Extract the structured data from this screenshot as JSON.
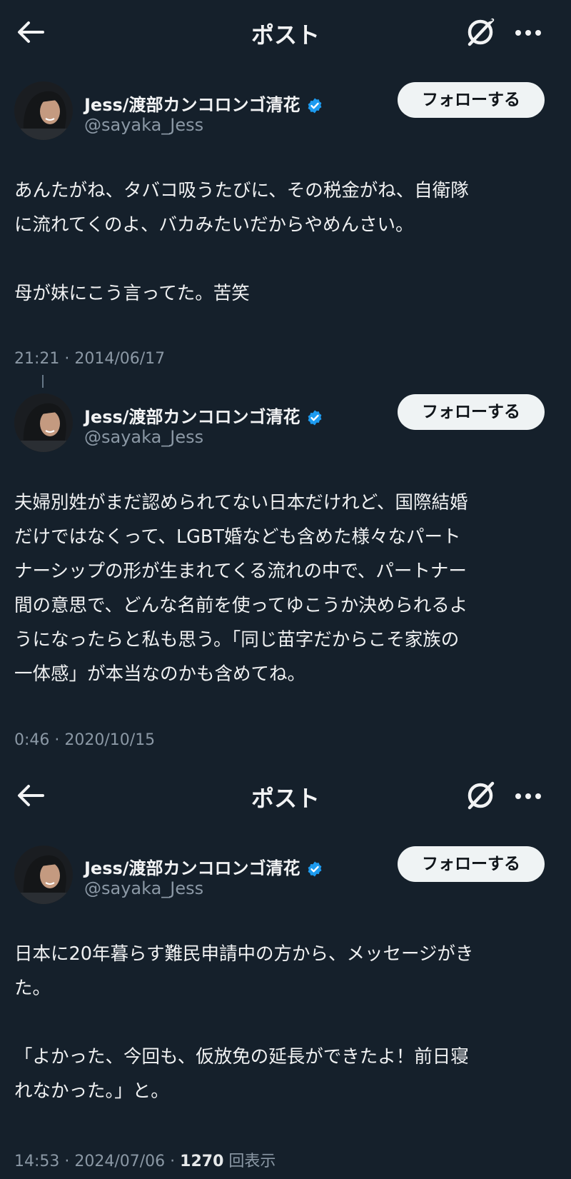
{
  "headers": [
    {
      "title": "ポスト",
      "icons": [
        "back-arrow-icon",
        "grok-icon",
        "more-icon"
      ]
    },
    {
      "title": "ポスト",
      "icons": [
        "back-arrow-icon",
        "grok-icon",
        "more-icon"
      ]
    }
  ],
  "posts": [
    {
      "author": {
        "name": "Jess/渡部カンコロンゴ清花",
        "handle": "@sayaka_Jess",
        "verified": true
      },
      "follow_label": "フォローする",
      "text": "あんたがね、タバコ吸うたびに、その税金がね、自衛隊\nに流れてくのよ、バカみたいだからやめんさい。\n\n母が妹にこう言ってた。苦笑",
      "timestamp": "21:21 · 2014/06/17"
    },
    {
      "author": {
        "name": "Jess/渡部カンコロンゴ清花",
        "handle": "@sayaka_Jess",
        "verified": true
      },
      "follow_label": "フォローする",
      "text": "夫婦別姓がまだ認められてない日本だけれど、国際結婚\nだけではなくって、LGBT婚なども含めた様々なパート\nナーシップの形が生まれてくる流れの中で、パートナー\n間の意思で、どんな名前を使ってゆこうか決められるよ\nうになったらと私も思う。「同じ苗字だからこそ家族の\n一体感」が本当なのかも含めてね。",
      "timestamp": "0:46 · 2020/10/15"
    },
    {
      "author": {
        "name": "Jess/渡部カンコロンゴ清花",
        "handle": "@sayaka_Jess",
        "verified": true
      },
      "follow_label": "フォローする",
      "text": "日本に20年暮らす難民申請中の方から、メッセージがき\nた。\n\n「よかった、今回も、仮放免の延長ができたよ！前日寝\nれなかった。」と。",
      "timestamp": "14:53 · 2024/07/06 · ",
      "views_count": "1270",
      "views_label": "回表示"
    }
  ],
  "colors": {
    "background": "#15202b",
    "text": "#e7e9ea",
    "secondary": "#8b98a5",
    "verified": "#1d9bf0",
    "follow_bg": "#eff3f4"
  }
}
